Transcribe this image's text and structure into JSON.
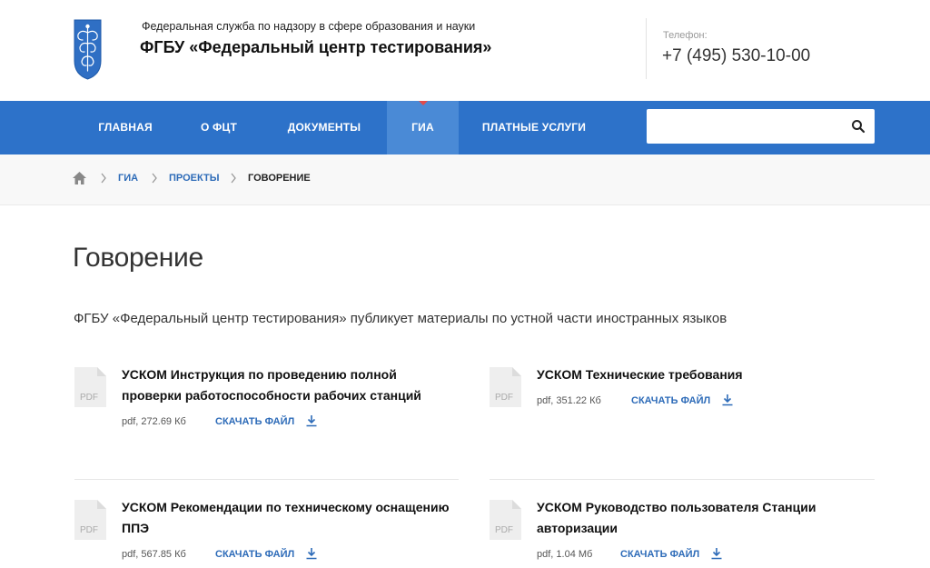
{
  "header": {
    "org_subtitle": "Федеральная служба по надзору в сфере образования и науки",
    "org_title": "ФГБУ «Федеральный центр тестирования»",
    "phone_label": "Телефон:",
    "phone_value": "+7 (495) 530-10-00"
  },
  "nav": {
    "items": [
      {
        "label": "ГЛАВНАЯ"
      },
      {
        "label": "О ФЦТ"
      },
      {
        "label": "ДОКУМЕНТЫ"
      },
      {
        "label": "ГИА",
        "active": true
      },
      {
        "label": "ПЛАТНЫЕ УСЛУГИ"
      }
    ]
  },
  "search": {
    "value": "",
    "placeholder": ""
  },
  "breadcrumb": [
    {
      "label": "ГИА"
    },
    {
      "label": "ПРОЕКТЫ"
    },
    {
      "label": "ГОВОРЕНИЕ",
      "current": true
    }
  ],
  "page": {
    "title": "Говорение",
    "intro": "ФГБУ «Федеральный центр тестирования» публикует материалы по устной части иностранных языков"
  },
  "files": [
    {
      "title": "УСКОМ Инструкция по проведению полной проверки работоспособности рабочих станций",
      "meta": "pdf, 272.69 Кб",
      "download_label": "СКАЧАТЬ ФАЙЛ",
      "icon_label": "PDF"
    },
    {
      "title": "УСКОМ Технические требования",
      "meta": "pdf, 351.22 Кб",
      "download_label": "СКАЧАТЬ ФАЙЛ",
      "icon_label": "PDF"
    },
    {
      "title": "УСКОМ Рекомендации по техническому оснащению ППЭ",
      "meta": "pdf, 567.85 Кб",
      "download_label": "СКАЧАТЬ ФАЙЛ",
      "icon_label": "PDF"
    },
    {
      "title": "УСКОМ Руководство пользователя Станции авторизации",
      "meta": "pdf, 1.04 Мб",
      "download_label": "СКАЧАТЬ ФАЙЛ",
      "icon_label": "PDF"
    }
  ],
  "colors": {
    "nav_bg": "#2d72c9",
    "nav_active_bg": "#4a8ad6",
    "nav_active_marker": "#e14b4b",
    "link": "#2d6bb8",
    "logo_shield": "#2f6fc4"
  },
  "icons": {
    "logo": "emblem-shield-icon",
    "search": "search-icon",
    "home": "home-icon",
    "breadcrumb_separator": "chevron-right-icon",
    "file": "pdf-file-icon",
    "download": "download-icon"
  }
}
